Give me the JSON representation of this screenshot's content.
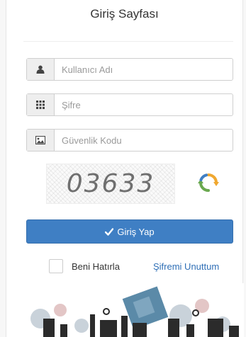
{
  "page": {
    "title": "Giriş Sayfası"
  },
  "fields": {
    "username_placeholder": "Kullanıcı Adı",
    "password_placeholder": "Şifre",
    "captcha_placeholder": "Güvenlik Kodu"
  },
  "captcha": {
    "code": "03633"
  },
  "login_button": {
    "label": "Giriş Yap"
  },
  "remember": {
    "label": "Beni Hatırla",
    "checked": false
  },
  "forgot": {
    "label": "Şifremi Unuttum"
  },
  "icons": {
    "username": "user-icon",
    "password": "keypad-icon",
    "captcha": "image-icon",
    "refresh": "refresh-icon",
    "submit": "checkmark-icon"
  },
  "colors": {
    "primary": "#3f7fc4",
    "link": "#2f6fb6",
    "refresh_accent": "#f0a830"
  }
}
